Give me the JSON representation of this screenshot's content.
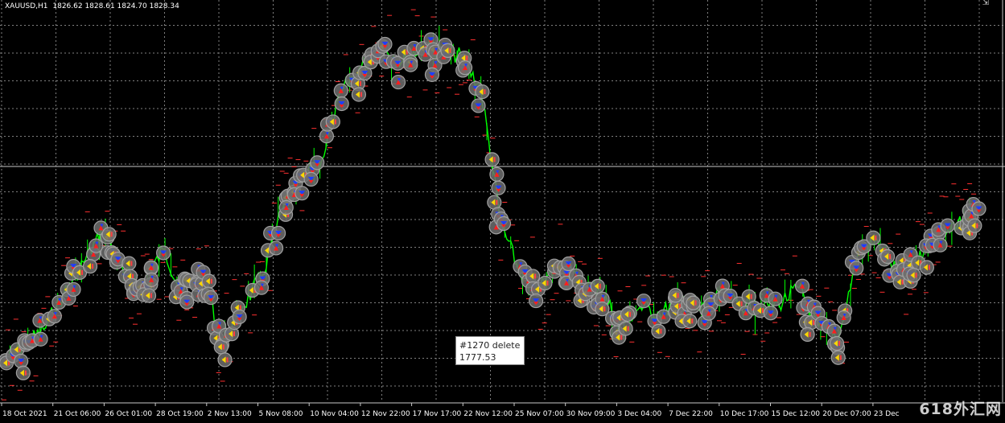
{
  "header": {
    "symbol": "XAUUSD,H1",
    "ohlc": "1826.62 1828.61 1824.70 1828.34"
  },
  "tooltip": {
    "title": "#1270 delete",
    "value": "1777.53"
  },
  "watermark": "618外汇网",
  "corner_mark": "⇲",
  "colors": {
    "background": "#000000",
    "grid": "#7f7f7f",
    "price_line": "#00ff00",
    "marker_ring": "#a0a0a0",
    "buy_arrow": "#1f3dff",
    "sell_arrow": "#ff1e1e",
    "close_arrow": "#ffd700",
    "level_dash": "#ff3030",
    "axis_text": "#ffffff"
  },
  "x_axis": {
    "labels": [
      "18 Oct 2021",
      "21 Oct 06:00",
      "26 Oct 01:00",
      "28 Oct 19:00",
      "2 Nov 13:00",
      "5 Nov 08:00",
      "10 Nov 04:00",
      "12 Nov 22:00",
      "17 Nov 17:00",
      "22 Nov 12:00",
      "25 Nov 07:00",
      "30 Nov 09:00",
      "3 Dec 04:00",
      "7 Dec 22:00",
      "10 Dec 17:00",
      "15 Dec 12:00",
      "20 Dec 07:00",
      "23 Dec"
    ]
  },
  "chart_data": {
    "type": "line",
    "series": [
      {
        "name": "XAUUSD,H1",
        "points": [
          [
            "18 Oct 2021",
            1765
          ],
          [
            "19 Oct",
            1770
          ],
          [
            "20 Oct",
            1775
          ],
          [
            "21 Oct 06:00",
            1786
          ],
          [
            "22 Oct",
            1796
          ],
          [
            "25 Oct",
            1806
          ],
          [
            "26 Oct 01:00",
            1793
          ],
          [
            "27 Oct",
            1788
          ],
          [
            "28 Oct 19:00",
            1800
          ],
          [
            "29 Oct",
            1787
          ],
          [
            "1 Nov",
            1792
          ],
          [
            "2 Nov 13:00",
            1770
          ],
          [
            "3 Nov",
            1782
          ],
          [
            "4 Nov",
            1792
          ],
          [
            "5 Nov 08:00",
            1812
          ],
          [
            "8 Nov",
            1822
          ],
          [
            "9 Nov",
            1828
          ],
          [
            "10 Nov 04:00",
            1849
          ],
          [
            "11 Nov",
            1857
          ],
          [
            "12 Nov 22:00",
            1864
          ],
          [
            "15 Nov",
            1858
          ],
          [
            "16 Nov",
            1863
          ],
          [
            "17 Nov 17:00",
            1862
          ],
          [
            "18 Nov",
            1860
          ],
          [
            "19 Nov",
            1850
          ],
          [
            "22 Nov 12:00",
            1808
          ],
          [
            "23 Nov",
            1792
          ],
          [
            "24 Nov",
            1788
          ],
          [
            "25 Nov 07:00",
            1796
          ],
          [
            "26 Nov",
            1789
          ],
          [
            "29 Nov",
            1788
          ],
          [
            "30 Nov 09:00",
            1776
          ],
          [
            "1 Dec",
            1782
          ],
          [
            "2 Dec",
            1780
          ],
          [
            "3 Dec 04:00",
            1784
          ],
          [
            "6 Dec",
            1781
          ],
          [
            "7 Dec 22:00",
            1786
          ],
          [
            "8 Dec",
            1783
          ],
          [
            "9 Dec",
            1782
          ],
          [
            "10 Dec 17:00",
            1783
          ],
          [
            "13 Dec",
            1788
          ],
          [
            "14 Dec",
            1776
          ],
          [
            "15 Dec 12:00",
            1772
          ],
          [
            "16 Dec",
            1800
          ],
          [
            "17 Dec",
            1802
          ],
          [
            "20 Dec 07:00",
            1792
          ],
          [
            "21 Dec",
            1796
          ],
          [
            "22 Dec",
            1806
          ],
          [
            "23 Dec",
            1808
          ],
          [
            "24 Dec",
            1812
          ]
        ]
      }
    ],
    "annotations": [
      {
        "text": "#1270 delete",
        "value": 1777.53
      }
    ]
  }
}
